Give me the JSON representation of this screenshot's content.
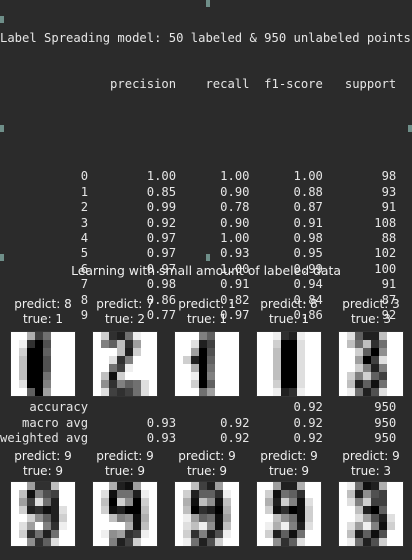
{
  "report": {
    "title_line": "Label Spreading model: 50 labeled & 950 unlabeled points",
    "header": [
      "precision",
      "recall",
      "f1-score",
      "support"
    ],
    "rows": [
      {
        "label": "0",
        "precision": "1.00",
        "recall": "1.00",
        "f1": "1.00",
        "support": "98"
      },
      {
        "label": "1",
        "precision": "0.85",
        "recall": "0.90",
        "f1": "0.88",
        "support": "93"
      },
      {
        "label": "2",
        "precision": "0.99",
        "recall": "0.78",
        "f1": "0.87",
        "support": "91"
      },
      {
        "label": "3",
        "precision": "0.92",
        "recall": "0.90",
        "f1": "0.91",
        "support": "108"
      },
      {
        "label": "4",
        "precision": "0.97",
        "recall": "1.00",
        "f1": "0.98",
        "support": "88"
      },
      {
        "label": "5",
        "precision": "0.97",
        "recall": "0.93",
        "f1": "0.95",
        "support": "102"
      },
      {
        "label": "6",
        "precision": "0.97",
        "recall": "1.00",
        "f1": "0.99",
        "support": "100"
      },
      {
        "label": "7",
        "precision": "0.98",
        "recall": "0.91",
        "f1": "0.94",
        "support": "91"
      },
      {
        "label": "8",
        "precision": "0.86",
        "precision_note": "",
        "recall": "0.82",
        "f1": "0.84",
        "support": "87"
      },
      {
        "label": "9",
        "precision": "0.77",
        "recall": "0.97",
        "f1": "0.86",
        "support": "92"
      }
    ],
    "summary": [
      {
        "label": "accuracy",
        "precision": "",
        "recall": "",
        "f1": "0.92",
        "support": "950"
      },
      {
        "label": "macro avg",
        "precision": "0.93",
        "recall": "0.92",
        "f1": "0.92",
        "support": "950"
      },
      {
        "label": "weighted avg",
        "precision": "0.93",
        "recall": "0.92",
        "f1": "0.92",
        "support": "950"
      }
    ]
  },
  "figure": {
    "title": "Learning with small amount of labeled data",
    "panels": [
      {
        "predict": "predict: 8",
        "true": "true: 1",
        "pixels": [
          [
            0,
            0,
            5,
            12,
            9,
            0,
            0,
            0
          ],
          [
            0,
            1,
            13,
            16,
            11,
            0,
            0,
            0
          ],
          [
            0,
            3,
            16,
            16,
            10,
            0,
            0,
            0
          ],
          [
            0,
            4,
            16,
            16,
            11,
            0,
            0,
            0
          ],
          [
            0,
            4,
            16,
            16,
            11,
            0,
            0,
            0
          ],
          [
            0,
            4,
            16,
            16,
            9,
            0,
            0,
            0
          ],
          [
            0,
            2,
            16,
            16,
            8,
            0,
            0,
            0
          ],
          [
            0,
            0,
            10,
            16,
            6,
            0,
            0,
            0
          ]
        ]
      },
      {
        "predict": "predict: 7",
        "true": "true: 2",
        "pixels": [
          [
            0,
            3,
            13,
            14,
            9,
            1,
            0,
            0
          ],
          [
            0,
            8,
            10,
            4,
            13,
            6,
            0,
            0
          ],
          [
            0,
            0,
            0,
            4,
            14,
            3,
            0,
            0
          ],
          [
            0,
            0,
            2,
            13,
            8,
            0,
            0,
            0
          ],
          [
            0,
            0,
            9,
            12,
            1,
            0,
            0,
            0
          ],
          [
            0,
            4,
            15,
            3,
            0,
            0,
            0,
            0
          ],
          [
            0,
            7,
            13,
            8,
            10,
            9,
            2,
            0
          ],
          [
            0,
            2,
            12,
            13,
            12,
            9,
            2,
            0
          ]
        ]
      },
      {
        "predict": "predict: 1",
        "true": "true: 1",
        "pixels": [
          [
            0,
            0,
            0,
            8,
            10,
            0,
            0,
            0
          ],
          [
            0,
            0,
            2,
            14,
            12,
            0,
            0,
            0
          ],
          [
            0,
            0,
            6,
            16,
            11,
            0,
            0,
            0
          ],
          [
            0,
            3,
            14,
            16,
            10,
            0,
            0,
            0
          ],
          [
            0,
            0,
            5,
            16,
            9,
            0,
            0,
            0
          ],
          [
            0,
            0,
            1,
            16,
            8,
            0,
            0,
            0
          ],
          [
            0,
            0,
            3,
            16,
            10,
            0,
            0,
            0
          ],
          [
            0,
            0,
            0,
            9,
            6,
            0,
            0,
            0
          ]
        ]
      },
      {
        "predict": "predict: 8",
        "true": "true: 1",
        "pixels": [
          [
            0,
            0,
            1,
            13,
            14,
            1,
            0,
            0
          ],
          [
            0,
            0,
            3,
            16,
            16,
            2,
            0,
            0
          ],
          [
            0,
            0,
            4,
            16,
            16,
            2,
            0,
            0
          ],
          [
            0,
            0,
            4,
            16,
            16,
            2,
            0,
            0
          ],
          [
            0,
            0,
            4,
            16,
            16,
            2,
            0,
            0
          ],
          [
            0,
            0,
            4,
            16,
            16,
            2,
            0,
            0
          ],
          [
            0,
            0,
            3,
            16,
            16,
            2,
            0,
            0
          ],
          [
            0,
            0,
            1,
            14,
            13,
            1,
            0,
            0
          ]
        ]
      },
      {
        "predict": "predict: 3",
        "true": "true: 3",
        "pixels": [
          [
            0,
            2,
            10,
            14,
            14,
            4,
            0,
            0
          ],
          [
            0,
            4,
            9,
            4,
            13,
            9,
            0,
            0
          ],
          [
            0,
            0,
            3,
            10,
            16,
            7,
            0,
            0
          ],
          [
            0,
            0,
            6,
            16,
            12,
            2,
            0,
            0
          ],
          [
            0,
            0,
            3,
            8,
            14,
            8,
            0,
            0
          ],
          [
            0,
            3,
            8,
            3,
            10,
            12,
            0,
            0
          ],
          [
            0,
            4,
            14,
            10,
            15,
            9,
            0,
            0
          ],
          [
            0,
            1,
            9,
            14,
            11,
            2,
            0,
            0
          ]
        ]
      },
      {
        "predict": "predict: 9",
        "true": "true: 9",
        "pixels": [
          [
            0,
            0,
            6,
            13,
            13,
            4,
            0,
            0
          ],
          [
            0,
            4,
            15,
            8,
            11,
            12,
            0,
            0
          ],
          [
            0,
            6,
            12,
            2,
            9,
            14,
            0,
            0
          ],
          [
            0,
            3,
            14,
            13,
            15,
            14,
            2,
            0
          ],
          [
            0,
            0,
            3,
            7,
            10,
            14,
            3,
            0
          ],
          [
            0,
            2,
            6,
            0,
            8,
            13,
            1,
            0
          ],
          [
            0,
            3,
            13,
            9,
            14,
            9,
            0,
            0
          ],
          [
            0,
            0,
            7,
            13,
            10,
            2,
            0,
            0
          ]
        ]
      },
      {
        "predict": "predict: 9",
        "true": "true: 9",
        "pixels": [
          [
            0,
            0,
            5,
            14,
            15,
            6,
            0,
            0
          ],
          [
            0,
            2,
            15,
            9,
            9,
            14,
            1,
            0
          ],
          [
            0,
            4,
            16,
            3,
            7,
            16,
            3,
            0
          ],
          [
            0,
            3,
            15,
            14,
            16,
            16,
            4,
            0
          ],
          [
            0,
            0,
            4,
            8,
            7,
            15,
            5,
            0
          ],
          [
            0,
            0,
            0,
            0,
            5,
            15,
            4,
            0
          ],
          [
            0,
            1,
            7,
            6,
            13,
            12,
            1,
            0
          ],
          [
            0,
            0,
            8,
            14,
            12,
            3,
            0,
            0
          ]
        ]
      },
      {
        "predict": "predict: 9",
        "true": "true: 9",
        "pixels": [
          [
            0,
            0,
            4,
            12,
            14,
            6,
            0,
            0
          ],
          [
            0,
            3,
            14,
            10,
            10,
            13,
            1,
            0
          ],
          [
            0,
            5,
            15,
            4,
            7,
            15,
            4,
            0
          ],
          [
            0,
            4,
            16,
            13,
            14,
            16,
            5,
            0
          ],
          [
            0,
            1,
            6,
            10,
            9,
            15,
            6,
            0
          ],
          [
            0,
            2,
            4,
            1,
            7,
            15,
            4,
            0
          ],
          [
            0,
            3,
            13,
            8,
            14,
            11,
            1,
            0
          ],
          [
            0,
            1,
            9,
            14,
            11,
            3,
            0,
            0
          ]
        ]
      },
      {
        "predict": "predict: 9",
        "true": "true: 9",
        "pixels": [
          [
            0,
            0,
            6,
            14,
            14,
            5,
            0,
            0
          ],
          [
            0,
            3,
            15,
            9,
            10,
            13,
            0,
            0
          ],
          [
            0,
            5,
            14,
            3,
            8,
            15,
            2,
            0
          ],
          [
            0,
            3,
            15,
            13,
            16,
            15,
            3,
            0
          ],
          [
            0,
            0,
            4,
            7,
            9,
            15,
            3,
            0
          ],
          [
            0,
            1,
            5,
            1,
            8,
            14,
            2,
            0
          ],
          [
            0,
            3,
            14,
            10,
            15,
            9,
            0,
            0
          ],
          [
            0,
            0,
            7,
            13,
            10,
            2,
            0,
            0
          ]
        ]
      },
      {
        "predict": "predict: 9",
        "true": "true: 3",
        "pixels": [
          [
            0,
            1,
            9,
            15,
            14,
            5,
            0,
            0
          ],
          [
            0,
            4,
            14,
            7,
            11,
            12,
            0,
            0
          ],
          [
            0,
            2,
            8,
            3,
            12,
            12,
            0,
            0
          ],
          [
            0,
            0,
            4,
            14,
            16,
            10,
            0,
            0
          ],
          [
            0,
            0,
            2,
            6,
            11,
            14,
            2,
            0
          ],
          [
            0,
            2,
            6,
            1,
            8,
            15,
            3,
            0
          ],
          [
            0,
            4,
            14,
            10,
            15,
            11,
            0,
            0
          ],
          [
            0,
            1,
            9,
            14,
            11,
            3,
            0,
            0
          ]
        ]
      }
    ]
  }
}
